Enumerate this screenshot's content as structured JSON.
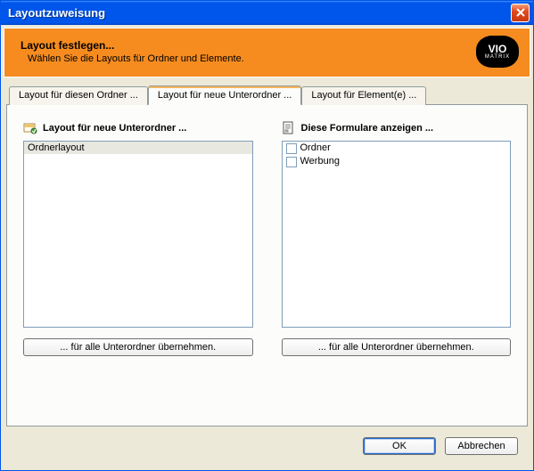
{
  "window": {
    "title": "Layoutzuweisung"
  },
  "banner": {
    "title": "Layout festlegen...",
    "subtitle": "Wählen Sie die Layouts für Ordner und Elemente.",
    "logo_top": "VIO",
    "logo_bottom": "MATRIX"
  },
  "tabs": {
    "folder": "Layout für diesen Ordner ...",
    "subfolders": "Layout für neue Unterordner ...",
    "elements": "Layout für Element(e) ..."
  },
  "left_panel": {
    "title": "Layout für neue Unterordner ...",
    "items": [
      "Ordnerlayout"
    ],
    "apply_label": "... für alle Unterordner übernehmen."
  },
  "right_panel": {
    "title": "Diese Formulare anzeigen ...",
    "items": [
      {
        "label": "Ordner",
        "checked": false
      },
      {
        "label": "Werbung",
        "checked": false
      }
    ],
    "apply_label": "... für alle Unterordner übernehmen."
  },
  "buttons": {
    "ok": "OK",
    "cancel": "Abbrechen"
  }
}
